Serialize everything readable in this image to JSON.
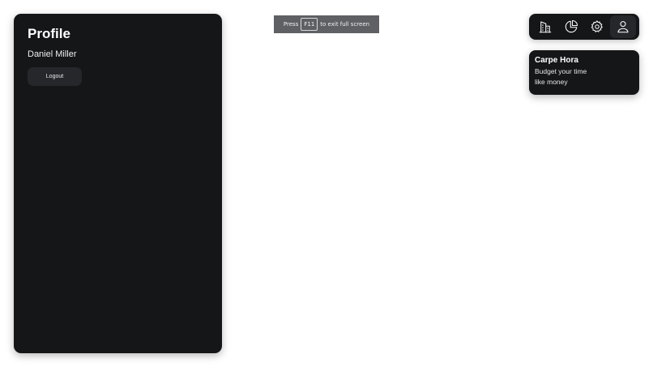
{
  "profile": {
    "title": "Profile",
    "user_name": "Daniel Miller",
    "logout_label": "Logout"
  },
  "fullscreen_notice": {
    "prefix": "Press",
    "key": "F11",
    "suffix": "to exit full screen"
  },
  "nav": {
    "items": [
      {
        "icon": "city-buildings-icon",
        "label": "Dashboard"
      },
      {
        "icon": "pie-chart-icon",
        "label": "Statistics"
      },
      {
        "icon": "gear-icon",
        "label": "Settings"
      },
      {
        "icon": "user-icon",
        "label": "Profile"
      }
    ],
    "active_index": 3
  },
  "info_card": {
    "title": "Carpe Hora",
    "line1": "Budget your time",
    "line2": "like money"
  },
  "colors": {
    "panel_background": "#151618",
    "button_background": "#26272a",
    "toast_background": "#5e6064",
    "page_background": "#ffffff"
  }
}
